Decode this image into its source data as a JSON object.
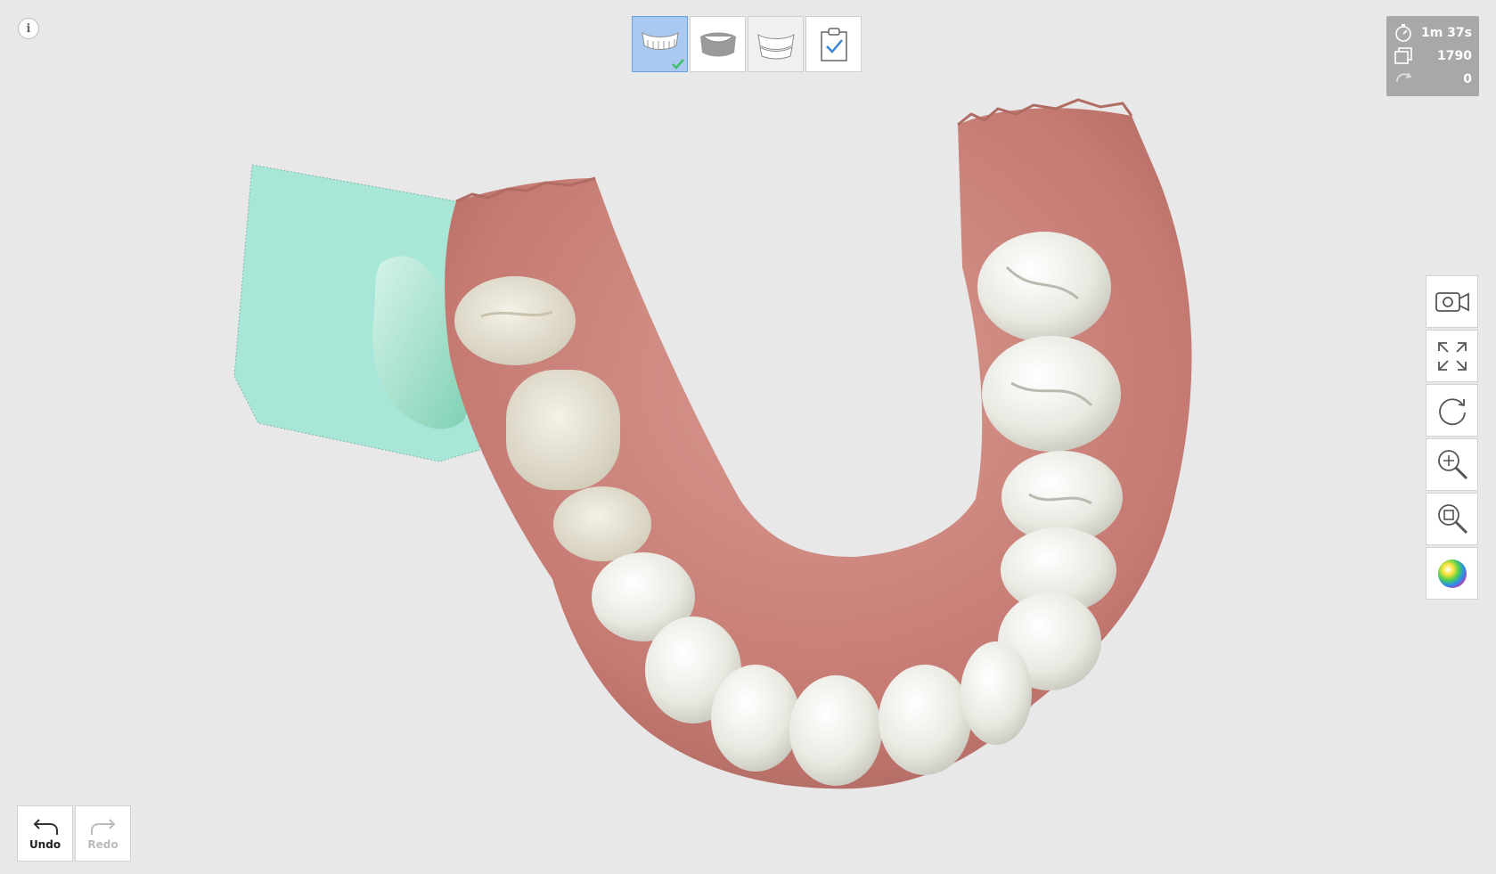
{
  "info_label": "i",
  "stages": [
    {
      "name": "upper-jaw",
      "active": true,
      "completed": true
    },
    {
      "name": "lower-jaw",
      "active": false,
      "completed": false
    },
    {
      "name": "occlusion",
      "active": false,
      "completed": false
    },
    {
      "name": "review",
      "active": false,
      "completed": false
    }
  ],
  "stats": {
    "scan_time": "1m 37s",
    "frame_count": "1790",
    "rotation_count": "0"
  },
  "history": {
    "undo_label": "Undo",
    "redo_label": "Redo"
  },
  "right_toolbar": [
    "camera-icon",
    "fit-view-icon",
    "rotate-icon",
    "zoom-in-icon",
    "zoom-area-icon",
    "color-map-icon"
  ],
  "colors": {
    "background": "#e8e8e8",
    "active_stage": "#a9c9f0",
    "selection_region": "#a8e6d8",
    "gum": "#c9857c",
    "teeth": "#ecece4",
    "check": "#3fbf6a"
  }
}
